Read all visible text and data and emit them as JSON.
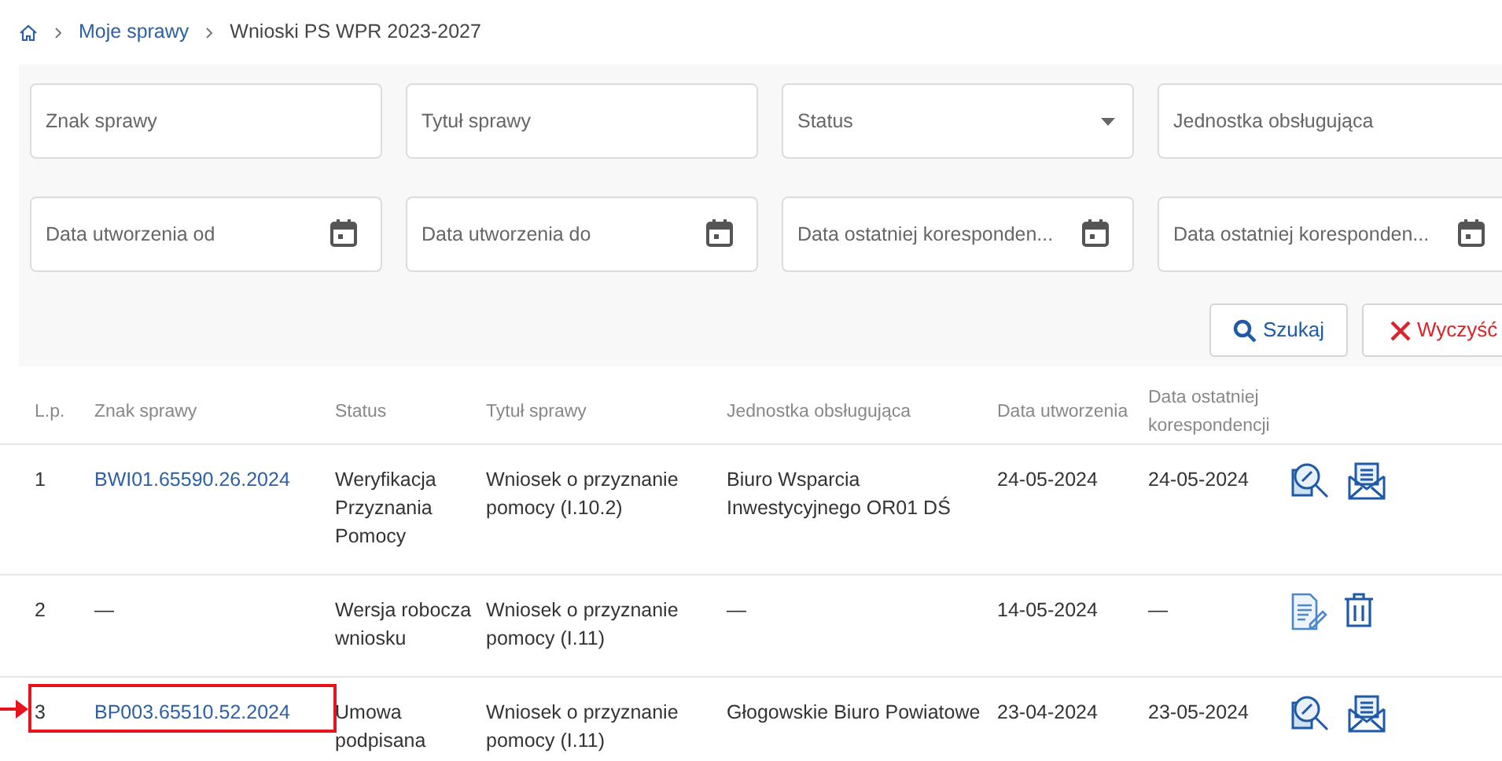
{
  "breadcrumb": {
    "items": [
      {
        "label": "Moje sprawy",
        "kind": "link"
      },
      {
        "label": "Wnioski PS WPR 2023-2027",
        "kind": "current"
      }
    ]
  },
  "filters": [
    {
      "placeholder": "Znak sprawy",
      "kind": "text"
    },
    {
      "placeholder": "Tytuł sprawy",
      "kind": "text"
    },
    {
      "placeholder": "Status",
      "kind": "select"
    },
    {
      "placeholder": "Jednostka obsługująca",
      "kind": "text"
    },
    {
      "placeholder": "Data utworzenia od",
      "kind": "date"
    },
    {
      "placeholder": "Data utworzenia do",
      "kind": "date"
    },
    {
      "placeholder": "Data ostatniej koresponden...",
      "kind": "date"
    },
    {
      "placeholder": "Data ostatniej koresponden...",
      "kind": "date"
    }
  ],
  "buttons": [
    {
      "label": "Szukaj",
      "kind": "search"
    },
    {
      "label": "Wyczyść",
      "kind": "clear"
    }
  ],
  "table": {
    "columns": [
      "L.p.",
      "Znak sprawy",
      "Status",
      "Tytuł sprawy",
      "Jednostka obsługująca",
      "Data utworzenia",
      "Data ostatniej korespondencji"
    ],
    "rows": [
      {
        "lp": "1",
        "znak": "BWI01.65590.26.2024",
        "kind": "case",
        "status": "Weryfikacja Przyznania Pomocy",
        "tytul": "Wniosek o przyznanie pomocy (I.10.2)",
        "jednostka": "Biuro Wsparcia Inwestycyjnego OR01 DŚ",
        "utworzenia": "24-05-2024",
        "ostatniej": "24-05-2024",
        "highlighted": false
      },
      {
        "lp": "2",
        "znak": "—",
        "kind": "draft",
        "status": "Wersja robocza wniosku",
        "tytul": "Wniosek o przyznanie pomocy (I.11)",
        "jednostka": "—",
        "utworzenia": "14-05-2024",
        "ostatniej": "—",
        "highlighted": false
      },
      {
        "lp": "3",
        "znak": "BP003.65510.52.2024",
        "kind": "case",
        "status": "Umowa podpisana",
        "tytul": "Wniosek o przyznanie pomocy (I.11)",
        "jednostka": "Głogowskie Biuro Powiatowe",
        "utworzenia": "23-04-2024",
        "ostatniej": "23-05-2024",
        "highlighted": true
      }
    ]
  }
}
